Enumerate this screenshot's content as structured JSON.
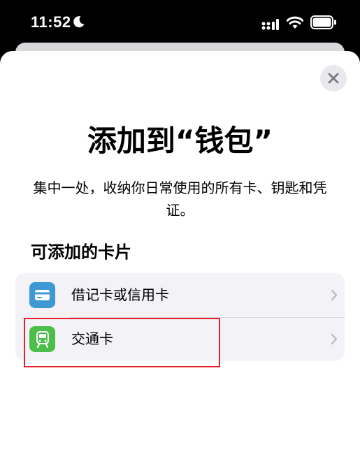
{
  "status_bar": {
    "time": "11:52",
    "icons": [
      "moon-icon",
      "signal-icon",
      "wifi-icon",
      "battery-icon"
    ]
  },
  "sheet": {
    "title": "添加到“钱包”",
    "subtitle": "集中一处，收纳你日常使用的所有卡、钥匙和凭证。",
    "section_header": "可添加的卡片",
    "close_icon": "close-icon",
    "cards": [
      {
        "label": "借记卡或信用卡",
        "icon": "credit-card-icon",
        "icon_color": "#3d98d4"
      },
      {
        "label": "交通卡",
        "icon": "train-icon",
        "icon_color": "#4cbf4a"
      }
    ]
  },
  "colors": {
    "highlight": "#e8212b",
    "list_background": "#f2f2f7",
    "close_button_background": "#e8e8ed"
  }
}
